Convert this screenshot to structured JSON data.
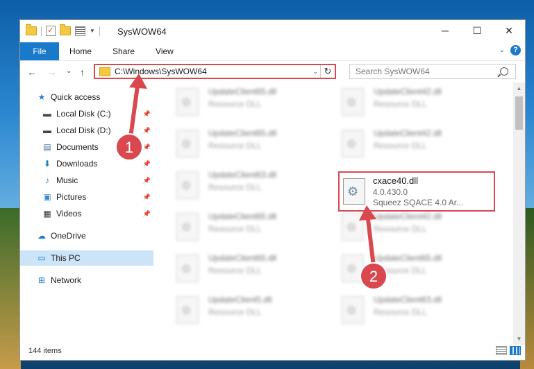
{
  "window": {
    "title": "SysWOW64",
    "controls": {
      "minimize": "─",
      "maximize": "☐",
      "close": "✕"
    }
  },
  "ribbon": {
    "file_tab": "File",
    "tabs": [
      "Home",
      "Share",
      "View"
    ]
  },
  "nav": {
    "back": "←",
    "forward": "→",
    "recent": "⌄",
    "up": "↑",
    "address": "C:\\Windows\\SysWOW64",
    "search_placeholder": "Search SysWOW64"
  },
  "sidebar": {
    "items": [
      {
        "label": "Quick access",
        "icon": "star-icon",
        "pinned": false
      },
      {
        "label": "Local Disk (C:)",
        "icon": "drive-icon",
        "pinned": true
      },
      {
        "label": "Local Disk (D:)",
        "icon": "drive-icon",
        "pinned": true
      },
      {
        "label": "Documents",
        "icon": "documents-icon",
        "pinned": true
      },
      {
        "label": "Downloads",
        "icon": "download-icon",
        "pinned": true
      },
      {
        "label": "Music",
        "icon": "music-icon",
        "pinned": true
      },
      {
        "label": "Pictures",
        "icon": "pictures-icon",
        "pinned": true
      },
      {
        "label": "Videos",
        "icon": "videos-icon",
        "pinned": true
      },
      {
        "label": "OneDrive",
        "icon": "cloud-icon",
        "pinned": false
      },
      {
        "label": "This PC",
        "icon": "computer-icon",
        "pinned": false,
        "active": true
      },
      {
        "label": "Network",
        "icon": "network-icon",
        "pinned": false
      }
    ]
  },
  "files": {
    "left": [
      {
        "name": "UpdateClient65.dll",
        "type": "Resource DLL"
      },
      {
        "name": "UpdateClient65.dll",
        "type": "Resource DLL"
      },
      {
        "name": "UpdateClient63.dll",
        "type": "Resource DLL"
      },
      {
        "name": "UpdateClient65.dll",
        "type": "Resource DLL"
      },
      {
        "name": "UpdateClient65.dll",
        "type": "Resource DLL"
      },
      {
        "name": "UpdateClient5.dll",
        "type": "Resource DLL"
      }
    ],
    "right": [
      {
        "name": "UpdateClient42.dll",
        "type": "Resource DLL"
      },
      {
        "name": "UpdateClient42.dll",
        "type": "Resource DLL"
      },
      {
        "name": "UpdateClient42.dll",
        "type": "Resource DLL"
      },
      {
        "name": "UpdateClient65.dll",
        "type": "Resource DLL"
      },
      {
        "name": "UpdateClient63.dll",
        "type": "Resource DLL"
      }
    ],
    "highlighted": {
      "name": "cxace40.dll",
      "version": "4.0.430.0",
      "description": "Squeez SQACE 4.0 Ar..."
    }
  },
  "status": {
    "item_count": "144 items"
  },
  "annotations": {
    "step1": "1",
    "step2": "2",
    "color": "#d9484f"
  }
}
